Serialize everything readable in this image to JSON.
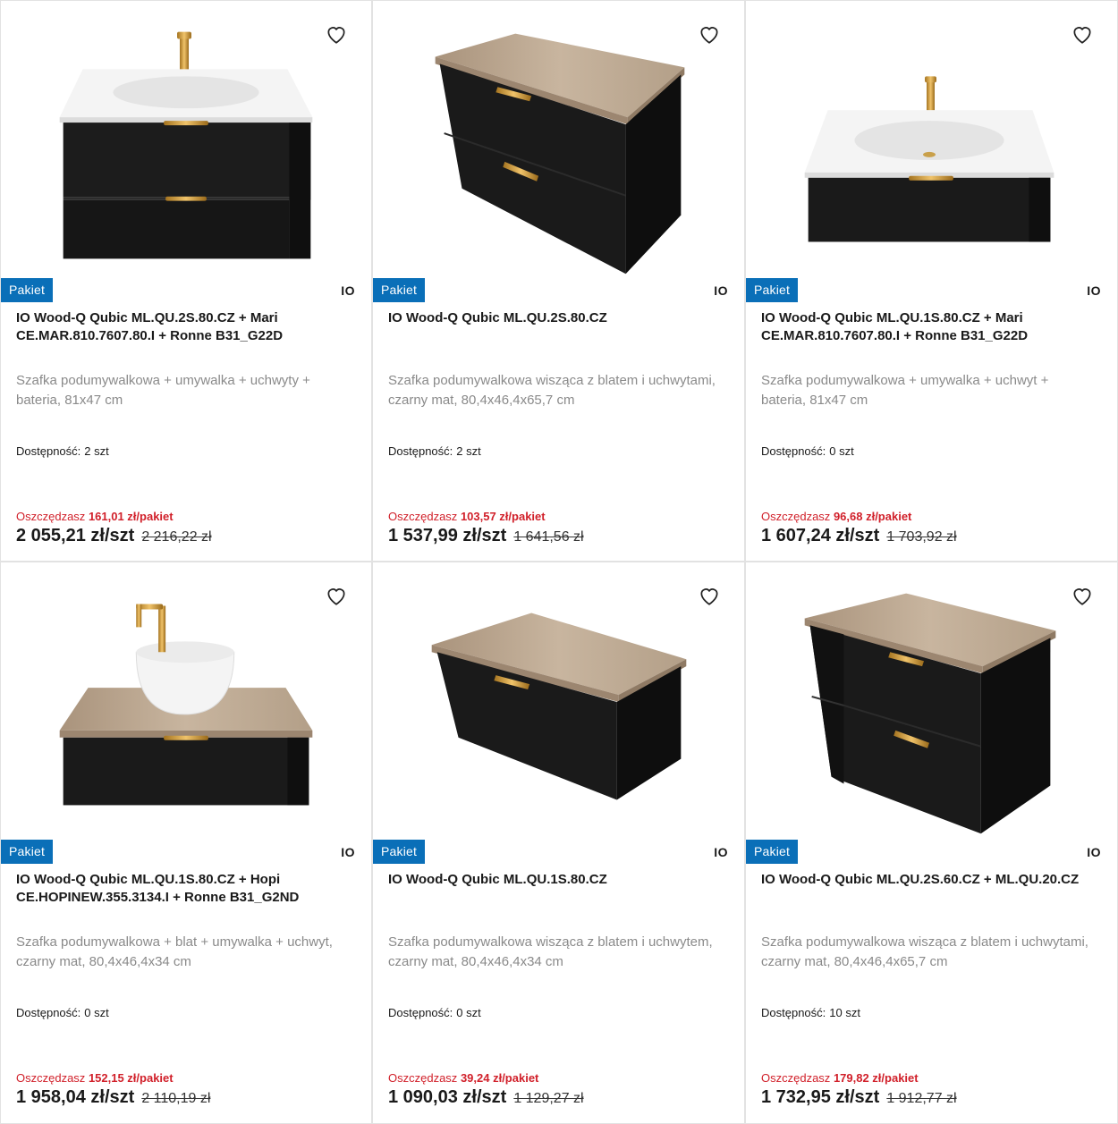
{
  "colors": {
    "badge": "#0a6fb8",
    "savings": "#d1202a"
  },
  "products": [
    {
      "image": "vanity-two-drawers-with-basin-and-gold-tap",
      "badge": "Pakiet",
      "brand": "IO",
      "title": "IO Wood-Q Qubic ML.QU.2S.80.CZ + Mari CE.MAR.810.7607.80.I + Ronne B31_G22D",
      "description": "Szafka podumywalkowa + umywalka + uchwyty + bateria, 81x47 cm",
      "availability_label": "Dostępność:",
      "availability_value": "2 szt",
      "savings_label": "Oszczędzasz",
      "savings_value": "161,01 zł/pakiet",
      "price": "2 055,21 zł/szt",
      "old_price": "2 216,22 zł"
    },
    {
      "image": "vanity-two-drawers-wood-top",
      "badge": "Pakiet",
      "brand": "IO",
      "title": "IO Wood-Q Qubic ML.QU.2S.80.CZ",
      "description": "Szafka podumywalkowa wisząca z blatem i uchwytami, czarny mat, 80,4x46,4x65,7 cm",
      "availability_label": "Dostępność:",
      "availability_value": "2 szt",
      "savings_label": "Oszczędzasz",
      "savings_value": "103,57 zł/pakiet",
      "price": "1 537,99 zł/szt",
      "old_price": "1 641,56 zł"
    },
    {
      "image": "vanity-one-drawer-with-basin-and-gold-tap",
      "badge": "Pakiet",
      "brand": "IO",
      "title": "IO Wood-Q Qubic ML.QU.1S.80.CZ + Mari CE.MAR.810.7607.80.I + Ronne B31_G22D",
      "description": "Szafka podumywalkowa + umywalka + uchwyt + bateria, 81x47 cm",
      "availability_label": "Dostępność:",
      "availability_value": "0 szt",
      "savings_label": "Oszczędzasz",
      "savings_value": "96,68 zł/pakiet",
      "price": "1 607,24 zł/szt",
      "old_price": "1 703,92 zł"
    },
    {
      "image": "vanity-one-drawer-wood-top-countertop-bowl",
      "badge": "Pakiet",
      "brand": "IO",
      "title": "IO Wood-Q Qubic ML.QU.1S.80.CZ + Hopi CE.HOPINEW.355.3134.I + Ronne B31_G2ND",
      "description": "Szafka podumywalkowa + blat + umywalka + uchwyt, czarny mat, 80,4x46,4x34 cm",
      "availability_label": "Dostępność:",
      "availability_value": "0 szt",
      "savings_label": "Oszczędzasz",
      "savings_value": "152,15 zł/pakiet",
      "price": "1 958,04 zł/szt",
      "old_price": "2 110,19 zł"
    },
    {
      "image": "vanity-one-drawer-wood-top",
      "badge": "Pakiet",
      "brand": "IO",
      "title": "IO Wood-Q Qubic ML.QU.1S.80.CZ",
      "description": "Szafka podumywalkowa wisząca z blatem i uchwytem, czarny mat, 80,4x46,4x34 cm",
      "availability_label": "Dostępność:",
      "availability_value": "0 szt",
      "savings_label": "Oszczędzasz",
      "savings_value": "39,24 zł/pakiet",
      "price": "1 090,03 zł/szt",
      "old_price": "1 129,27 zł"
    },
    {
      "image": "vanity-two-drawers-open-shelf-wood-top",
      "badge": "Pakiet",
      "brand": "IO",
      "title": "IO Wood-Q Qubic ML.QU.2S.60.CZ + ML.QU.20.CZ",
      "description": "Szafka podumywalkowa wisząca z blatem i uchwytami, czarny mat, 80,4x46,4x65,7 cm",
      "availability_label": "Dostępność:",
      "availability_value": "10 szt",
      "savings_label": "Oszczędzasz",
      "savings_value": "179,82 zł/pakiet",
      "price": "1 732,95 zł/szt",
      "old_price": "1 912,77 zł"
    }
  ]
}
